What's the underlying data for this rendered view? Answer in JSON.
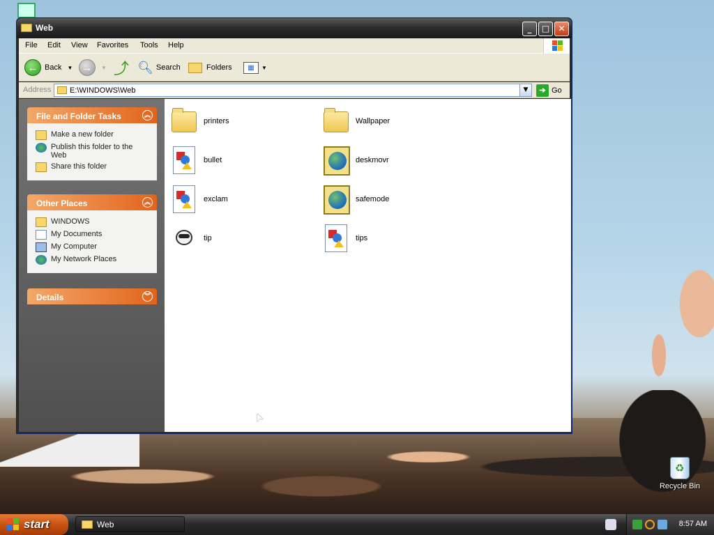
{
  "window": {
    "title": "Web",
    "menu": [
      "File",
      "Edit",
      "View",
      "Favorites",
      "Tools",
      "Help"
    ],
    "toolbar": {
      "back": "Back",
      "search": "Search",
      "folders": "Folders"
    },
    "address": {
      "label": "Address",
      "value": "E:\\WINDOWS\\Web",
      "go": "Go"
    },
    "panels": [
      {
        "title": "File and Folder Tasks",
        "items": [
          {
            "label": "Make a new folder",
            "icon": "new-folder-icon"
          },
          {
            "label": "Publish this folder to the Web",
            "icon": "publish-web-icon"
          },
          {
            "label": "Share this folder",
            "icon": "share-folder-icon"
          }
        ]
      },
      {
        "title": "Other Places",
        "items": [
          {
            "label": "WINDOWS",
            "icon": "folder-icon"
          },
          {
            "label": "My Documents",
            "icon": "my-documents-icon"
          },
          {
            "label": "My Computer",
            "icon": "my-computer-icon"
          },
          {
            "label": "My Network Places",
            "icon": "network-places-icon"
          }
        ]
      },
      {
        "title": "Details",
        "items": []
      }
    ],
    "files": [
      {
        "name": "printers",
        "type": "folder"
      },
      {
        "name": "Wallpaper",
        "type": "folder"
      },
      {
        "name": "bullet",
        "type": "image-doc"
      },
      {
        "name": "deskmovr",
        "type": "web-doc"
      },
      {
        "name": "exclam",
        "type": "image-doc"
      },
      {
        "name": "safemode",
        "type": "web-doc"
      },
      {
        "name": "tip",
        "type": "tip"
      },
      {
        "name": "tips",
        "type": "image-doc"
      }
    ]
  },
  "desktop": {
    "recycle_bin": "Recycle Bin"
  },
  "taskbar": {
    "start": "start",
    "task": "Web",
    "clock": "8:57 AM"
  }
}
